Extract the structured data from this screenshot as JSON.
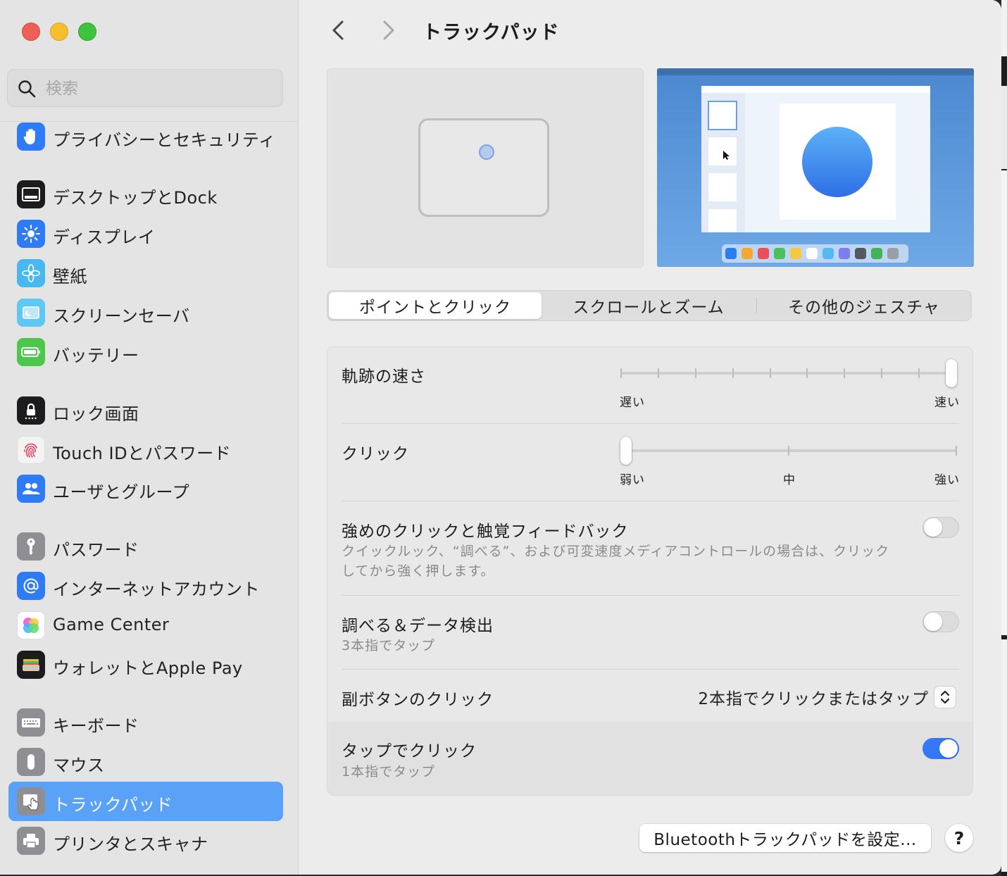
{
  "window": {
    "title": "トラックパッド"
  },
  "search": {
    "placeholder": "検索"
  },
  "sidebar": {
    "items": [
      {
        "label": "プライバシーとセキュリティ",
        "icon": "hand-icon",
        "color": "#2f7bf5"
      },
      {
        "label": "デスクトップとDock",
        "icon": "dock-icon",
        "color": "#1c1c1e"
      },
      {
        "label": "ディスプレイ",
        "icon": "sun-icon",
        "color": "#2f7bf5"
      },
      {
        "label": "壁紙",
        "icon": "flower-icon",
        "color": "#49b8f0"
      },
      {
        "label": "スクリーンセーバ",
        "icon": "screensaver-icon",
        "color": "#5ec8f2"
      },
      {
        "label": "バッテリー",
        "icon": "battery-icon",
        "color": "#4cc74c"
      },
      {
        "label": "ロック画面",
        "icon": "lock-icon",
        "color": "#1c1c1e"
      },
      {
        "label": "Touch IDとパスワード",
        "icon": "fingerprint-icon",
        "color": "#f3f3f3"
      },
      {
        "label": "ユーザとグループ",
        "icon": "users-icon",
        "color": "#2f7bf5"
      },
      {
        "label": "パスワード",
        "icon": "key-icon",
        "color": "#8e8e93"
      },
      {
        "label": "インターネットアカウント",
        "icon": "at-icon",
        "color": "#2f7bf5"
      },
      {
        "label": "Game Center",
        "icon": "game-center-icon",
        "color": "#ffffff"
      },
      {
        "label": "ウォレットとApple Pay",
        "icon": "wallet-icon",
        "color": "#1c1c1e"
      },
      {
        "label": "キーボード",
        "icon": "keyboard-icon",
        "color": "#8e8e93"
      },
      {
        "label": "マウス",
        "icon": "mouse-icon",
        "color": "#8e8e93"
      },
      {
        "label": "トラックパッド",
        "icon": "trackpad-icon",
        "color": "#8e8e93",
        "selected": true
      },
      {
        "label": "プリンタとスキャナ",
        "icon": "printer-icon",
        "color": "#8e8e93"
      }
    ]
  },
  "tabs": [
    {
      "label": "ポイントとクリック",
      "selected": true
    },
    {
      "label": "スクロールとズーム",
      "selected": false
    },
    {
      "label": "その他のジェスチャ",
      "selected": false
    }
  ],
  "settings": {
    "tracking_speed": {
      "label": "軌跡の速さ",
      "min_label": "遅い",
      "max_label": "速い",
      "steps": 10,
      "value": 1.0
    },
    "click": {
      "label": "クリック",
      "min_label": "弱い",
      "mid_label": "中",
      "max_label": "強い",
      "steps": 3,
      "value": 0
    },
    "force_click": {
      "label": "強めのクリックと触覚フィードバック",
      "description_line1": "クイックルック、“調べる”、および可変速度メディアコントロールの場合は、クリック",
      "description_line2": "してから強く押します。",
      "enabled": false
    },
    "lookup": {
      "label": "調べる＆データ検出",
      "description": "3本指でタップ",
      "enabled": false
    },
    "secondary_click": {
      "label": "副ボタンのクリック",
      "value": "2本指でクリックまたはタップ"
    },
    "tap_to_click": {
      "label": "タップでクリック",
      "description": "1本指でタップ",
      "enabled": true
    }
  },
  "buttons": {
    "bluetooth": "Bluetoothトラックパッドを設定...",
    "help": "?"
  },
  "colors": {
    "accent": "#3478f6",
    "selection": "#5aa2f7"
  }
}
